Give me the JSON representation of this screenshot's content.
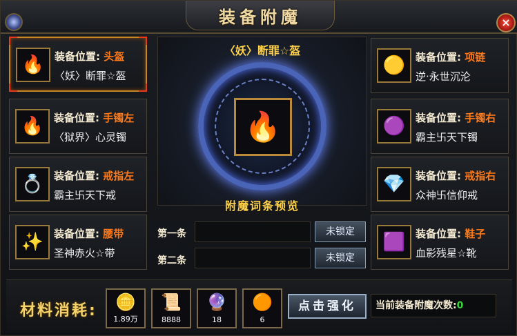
{
  "window": {
    "title": "装备附魔",
    "close_label": "×"
  },
  "slots": [
    {
      "label": "装备位置:",
      "position": "头盔",
      "name": "〈妖〉断罪☆盔",
      "icon": "helmet-icon",
      "glyph": "🔥"
    },
    {
      "label": "装备位置:",
      "position": "手镯左",
      "name": "〈狱界〉心灵镯",
      "icon": "bracelet-icon",
      "glyph": "🔥"
    },
    {
      "label": "装备位置:",
      "position": "戒指左",
      "name": "霸主卐天下戒",
      "icon": "ring-icon",
      "glyph": "💍"
    },
    {
      "label": "装备位置:",
      "position": "腰带",
      "name": "圣神赤火☆带",
      "icon": "belt-icon",
      "glyph": "✨"
    },
    {
      "label": "装备位置:",
      "position": "项链",
      "name": "逆·永世沉沦",
      "icon": "necklace-icon",
      "glyph": "🟡"
    },
    {
      "label": "装备位置:",
      "position": "手镯右",
      "name": "霸主卐天下镯",
      "icon": "bracelet-icon",
      "glyph": "🟣"
    },
    {
      "label": "装备位置:",
      "position": "戒指右",
      "name": "众神卐信仰戒",
      "icon": "ring-icon",
      "glyph": "💎"
    },
    {
      "label": "装备位置:",
      "position": "鞋子",
      "name": "血影残星☆靴",
      "icon": "boots-icon",
      "glyph": "🟪"
    }
  ],
  "center": {
    "selected_item": "〈妖〉断罪☆盔",
    "preview_title": "附魔词条预览",
    "lines": [
      {
        "label": "第一条",
        "value": "",
        "lock_label": "未锁定"
      },
      {
        "label": "第二条",
        "value": "",
        "lock_label": "未锁定"
      }
    ]
  },
  "materials": {
    "label": "材料消耗:",
    "items": [
      {
        "icon": "gold-ingot-icon",
        "glyph": "🪙",
        "count": "1.89万"
      },
      {
        "icon": "scroll-icon",
        "glyph": "📜",
        "count": "8888"
      },
      {
        "icon": "crystal-icon",
        "glyph": "🔮",
        "count": "18"
      },
      {
        "icon": "coin-icon",
        "glyph": "🟠",
        "count": "6"
      }
    ]
  },
  "enhance_button": "点击强化",
  "enchant_count": {
    "label": "当前装备附魔次数:",
    "value": "0"
  }
}
